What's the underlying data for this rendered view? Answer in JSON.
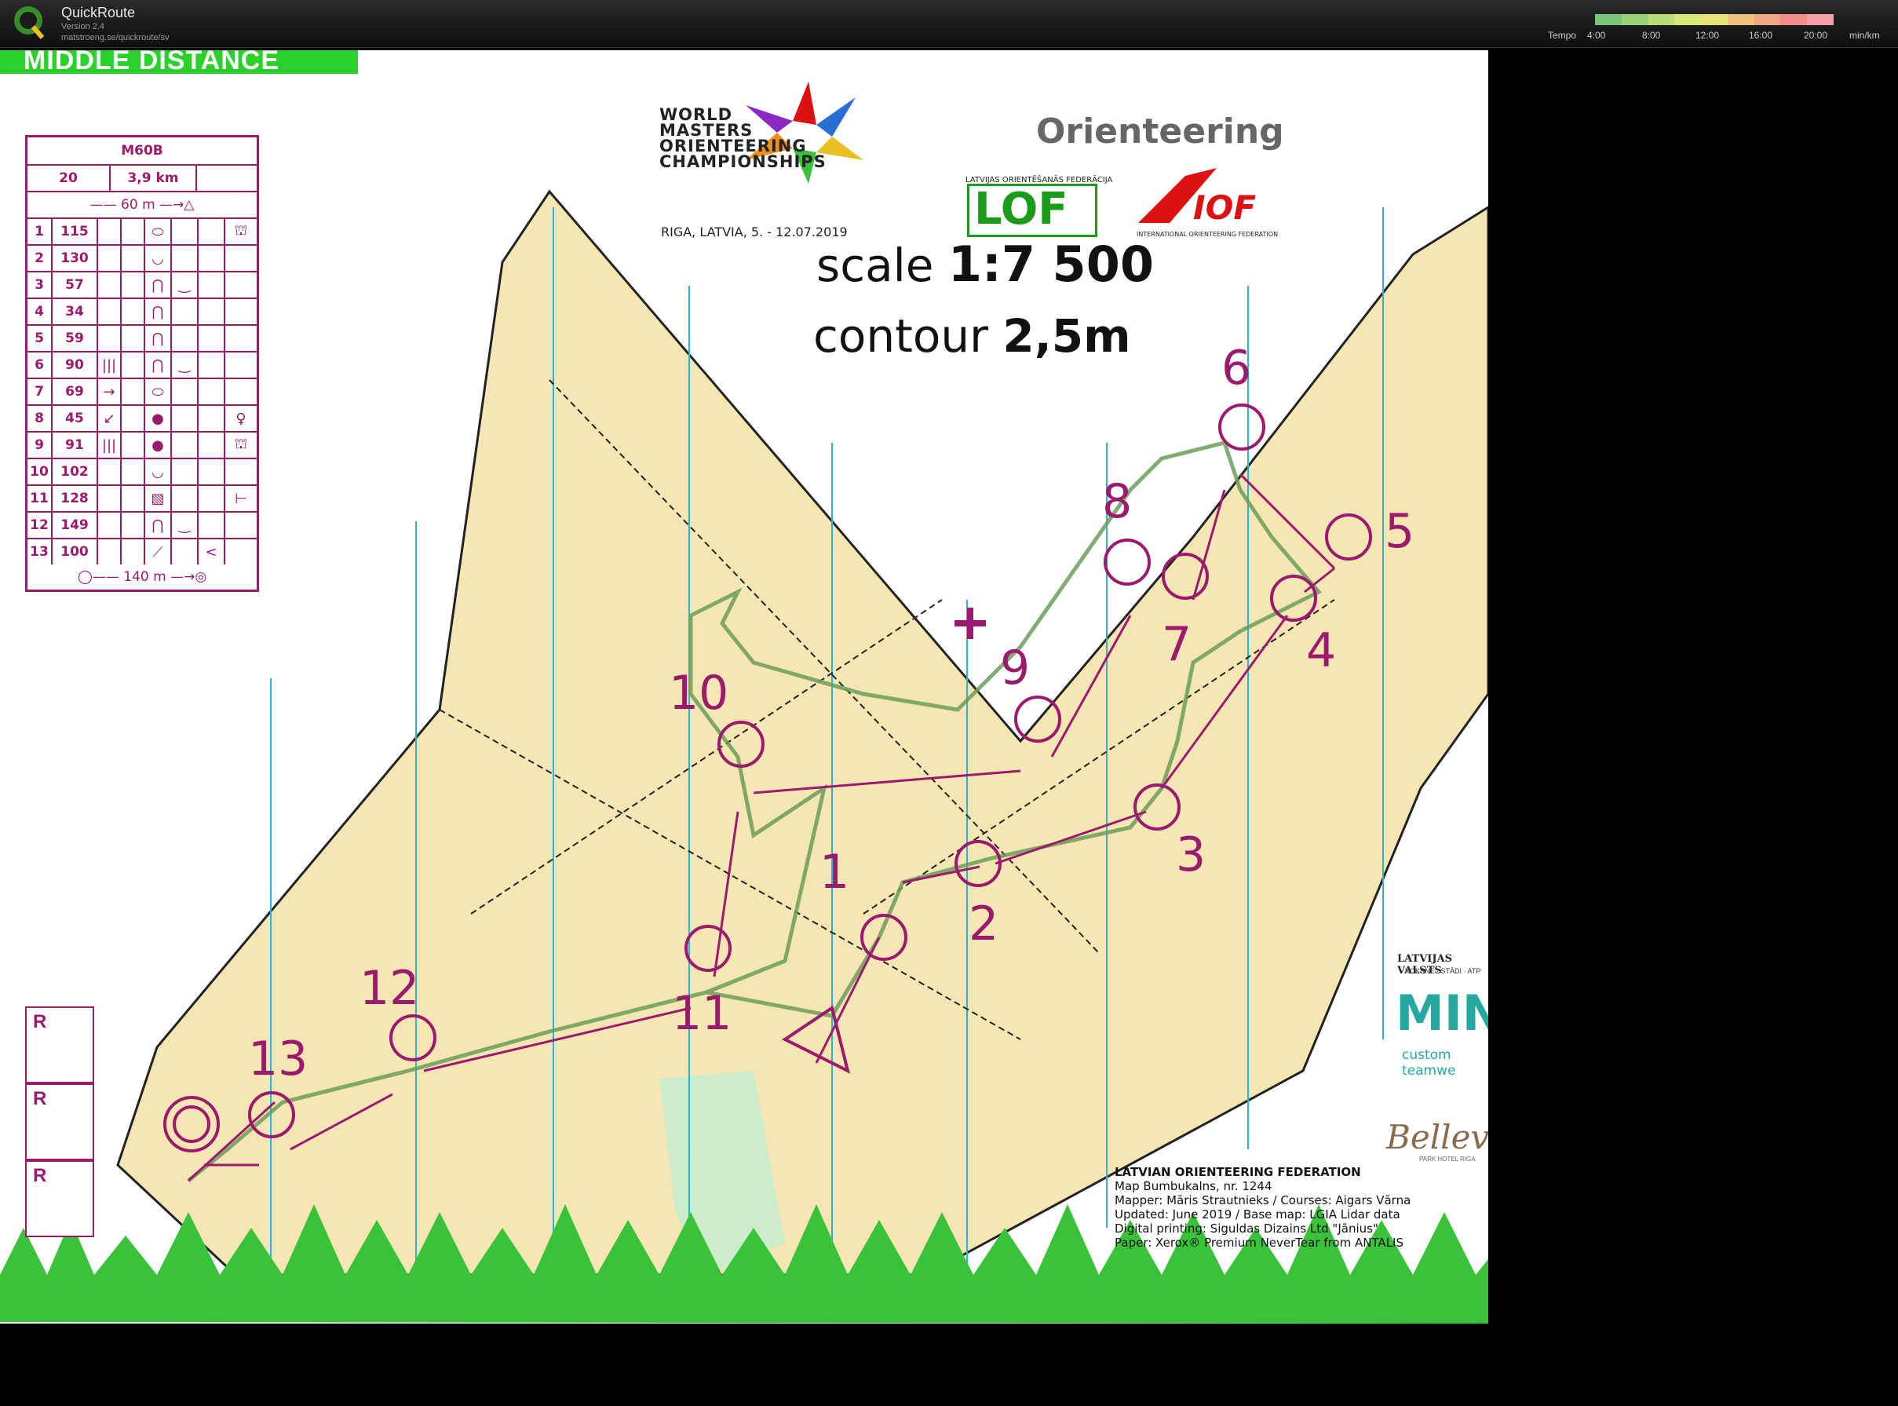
{
  "app": {
    "title": "QuickRoute",
    "version": "Version 2.4",
    "url": "matstroeng.se/quickroute/sv"
  },
  "tempo_scale": {
    "label": "Tempo",
    "ticks": [
      "4:00",
      "8:00",
      "12:00",
      "16:00",
      "20:00"
    ],
    "unit": "min/km",
    "colors": [
      "#7bc67b",
      "#9ad27a",
      "#b9dd78",
      "#d8e877",
      "#e8e27a",
      "#ecc47e",
      "#efa883",
      "#f08c8a",
      "#f4a0a6"
    ]
  },
  "map": {
    "banner": "MIDDLE DISTANCE",
    "scale_label": "scale",
    "scale_value": "1:7 500",
    "contour_label": "contour",
    "contour_value": "2,5m",
    "event_lines": [
      "WORLD",
      "MASTERS",
      "ORIENTEERING",
      "CHAMPIONSHIPS"
    ],
    "event_sub": "RIGA, LATVIA, 5. - 12.07.2019",
    "orienteering_logo": "Orienteering",
    "lof_sub": "LATVIJAS ORIENTĒŠANĀS FEDERĀCIJA",
    "lof_logo": "LOF",
    "iof_logo": "IOF",
    "iof_sub": "INTERNATIONAL ORIENTEERING FEDERATION",
    "credits": {
      "heading": "LATVIAN ORIENTEERING FEDERATION",
      "lines": [
        "Map Bumbukalns, nr. 1244",
        "Mapper: Māris Strautnieks / Courses: Aigars Vārna",
        "Updated: June 2019 / Base map: LGIA Lidar data",
        "Digital printing: Siguldas Dizains Ltd \"Jānius\"",
        "Paper: Xerox® Premium NeverTear from ANTALIS"
      ]
    },
    "sponsor1": "LATVIJAS VALSTS",
    "sponsor1_sub": "KOKSNE · STĀDI · ATP",
    "mint": "MINT",
    "mint_sub": "custom teamwe",
    "bellevue": "Bellevu",
    "bellevue_sub": "PARK HOTEL RIGA",
    "control_numbers": [
      "1",
      "2",
      "3",
      "4",
      "5",
      "6",
      "7",
      "8",
      "9",
      "10",
      "11",
      "12",
      "13"
    ],
    "reserve_boxes": [
      "R",
      "R",
      "R"
    ]
  },
  "description": {
    "class": "M60B",
    "controls_count": "20",
    "length": "3,9 km",
    "start_leg": "60 m",
    "finish_leg": "140 m",
    "rows": [
      {
        "n": "1",
        "code": "115",
        "c": "",
        "d": "",
        "e": "⬭",
        "f": "",
        "g": "",
        "h": "⛫"
      },
      {
        "n": "2",
        "code": "130",
        "c": "",
        "d": "",
        "e": "◡",
        "f": "",
        "g": "",
        "h": ""
      },
      {
        "n": "3",
        "code": "57",
        "c": "",
        "d": "",
        "e": "⋂",
        "f": "‿",
        "g": "",
        "h": ""
      },
      {
        "n": "4",
        "code": "34",
        "c": "",
        "d": "",
        "e": "⋂",
        "f": "",
        "g": "",
        "h": ""
      },
      {
        "n": "5",
        "code": "59",
        "c": "",
        "d": "",
        "e": "⋂",
        "f": "",
        "g": "",
        "h": ""
      },
      {
        "n": "6",
        "code": "90",
        "c": "|||",
        "d": "",
        "e": "⋂",
        "f": "‿",
        "g": "",
        "h": ""
      },
      {
        "n": "7",
        "code": "69",
        "c": "→",
        "d": "",
        "e": "⬭",
        "f": "",
        "g": "",
        "h": ""
      },
      {
        "n": "8",
        "code": "45",
        "c": "↙",
        "d": "",
        "e": "●",
        "f": "",
        "g": "",
        "h": "♀"
      },
      {
        "n": "9",
        "code": "91",
        "c": "|||",
        "d": "",
        "e": "●",
        "f": "",
        "g": "",
        "h": "⛫"
      },
      {
        "n": "10",
        "code": "102",
        "c": "",
        "d": "",
        "e": "◡",
        "f": "",
        "g": "",
        "h": ""
      },
      {
        "n": "11",
        "code": "128",
        "c": "",
        "d": "",
        "e": "▧",
        "f": "",
        "g": "",
        "h": "⊢"
      },
      {
        "n": "12",
        "code": "149",
        "c": "",
        "d": "",
        "e": "⋂",
        "f": "‿",
        "g": "",
        "h": ""
      },
      {
        "n": "13",
        "code": "100",
        "c": "",
        "d": "",
        "e": "⟋",
        "f": "",
        "g": "<",
        "h": ""
      }
    ]
  }
}
